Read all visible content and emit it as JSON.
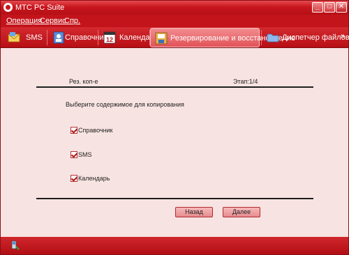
{
  "window": {
    "title": "МТС PC Suite"
  },
  "window_controls": {
    "minimize": "_",
    "maximize": "□",
    "close": "✕"
  },
  "menu": {
    "items": [
      "Операция",
      "Сервис",
      "Спр."
    ]
  },
  "tabs": [
    {
      "label": "SMS",
      "icon": "envelope-icon"
    },
    {
      "label": "Справочник",
      "icon": "contacts-book-icon"
    },
    {
      "label": "Календарь",
      "icon": "calendar-icon",
      "icon_text": "12"
    },
    {
      "label": "Резервирование и восстановление",
      "icon": "backup-restore-icon",
      "active": true
    },
    {
      "label": "Диспетчер файлов",
      "icon": "folder-icon"
    }
  ],
  "overflow": "»",
  "wizard": {
    "title_left": "Рез. коп-е",
    "step": "Этап:1/4",
    "instruction": "Выберите содержимое для копирования",
    "items": [
      {
        "label": "Справочник",
        "checked": true
      },
      {
        "label": "SMS",
        "checked": true
      },
      {
        "label": "Календарь",
        "checked": true
      }
    ],
    "back_label": "Назад",
    "next_label": "Далее"
  },
  "colors": {
    "brand_red": "#c3141b",
    "content_bg": "#f7e3e1"
  }
}
